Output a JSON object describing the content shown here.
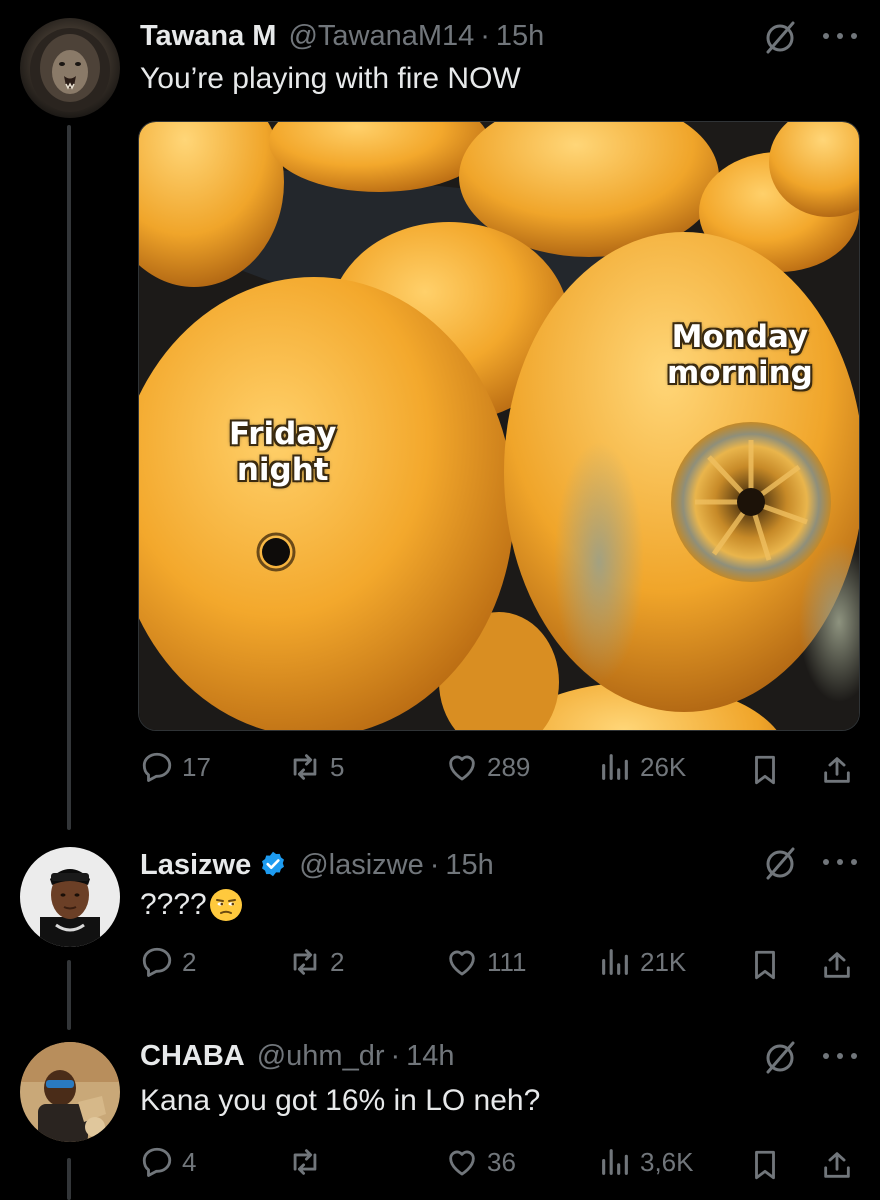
{
  "tweets": [
    {
      "name": "Tawana M",
      "handle": "@TawanaM14",
      "sep": "·",
      "time": "15h",
      "verified": false,
      "text": "You’re playing with fire NOW",
      "image": {
        "labels": {
          "left": [
            "Friday",
            "night"
          ],
          "right": [
            "Monday",
            "morning"
          ]
        }
      },
      "stats": {
        "replies": "17",
        "reposts": "5",
        "likes": "289",
        "views": "26K"
      }
    },
    {
      "name": "Lasizwe",
      "handle": "@lasizwe",
      "sep": "·",
      "time": "15h",
      "verified": true,
      "text": "????",
      "emoji": "unamused-face-emoji",
      "stats": {
        "replies": "2",
        "reposts": "2",
        "likes": "111",
        "views": "21K"
      }
    },
    {
      "name": "CHABA",
      "handle": "@uhm_dr",
      "sep": "·",
      "time": "14h",
      "verified": false,
      "text": "Kana you got 16% in LO neh?",
      "stats": {
        "replies": "4",
        "reposts": "",
        "likes": "36",
        "views": "3,6K"
      }
    }
  ],
  "icons": [
    "grok-icon",
    "more-icon",
    "reply-icon",
    "repost-icon",
    "like-icon",
    "views-icon",
    "bookmark-icon",
    "share-icon",
    "verified-badge-icon"
  ],
  "colors": {
    "background": "#000000",
    "text": "#e7e9ea",
    "muted": "#71767b",
    "verified": "#1d9bf0",
    "orange": "#f0a92a"
  }
}
